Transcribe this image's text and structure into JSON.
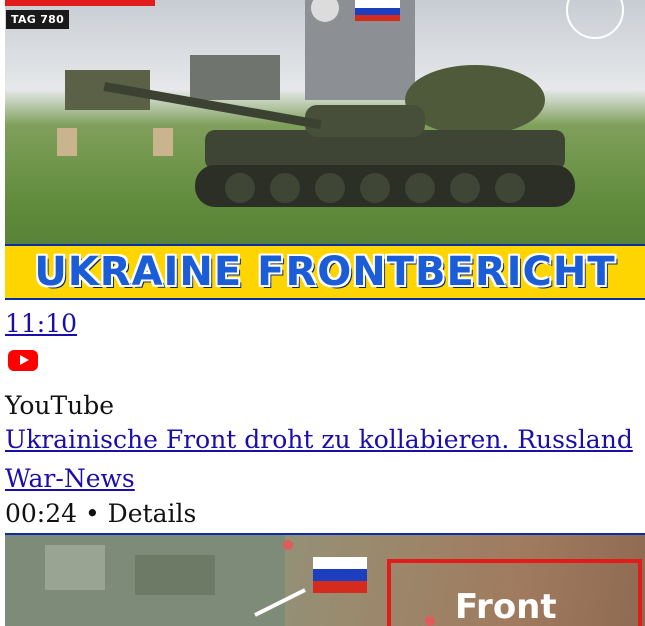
{
  "video1": {
    "tag": "TAG 780",
    "banner": "UKRAINE FRONTBERICHT",
    "duration": "11:10"
  },
  "result": {
    "source_icon": "youtube-icon",
    "source": "YouTube",
    "title": "Ukrainische Front droht zu kollabieren. Russland",
    "channel": "War-News",
    "meta": "00:24 • Details"
  },
  "video2": {
    "label": "Front"
  },
  "colors": {
    "link": "#1a0dab",
    "youtube_red": "#ff0000",
    "banner_yellow": "#ffd500",
    "banner_blue": "#1a5dd6",
    "frame_red": "#e21b1b"
  }
}
